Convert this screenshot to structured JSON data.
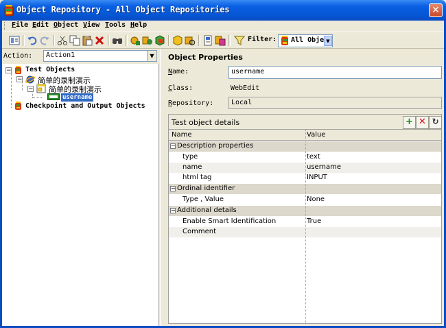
{
  "window": {
    "title": "Object Repository - All Object Repositories",
    "close_label": "✕"
  },
  "menu": [
    "File",
    "Edit",
    "Object",
    "View",
    "Tools",
    "Help"
  ],
  "toolbar": {
    "filter_label": "Filter:",
    "filter_value": "All Obje"
  },
  "action": {
    "label": "Action:",
    "value": "Action1"
  },
  "tree": {
    "root": "Test Objects",
    "browser": "简单的录制演示",
    "page": "简单的录制演示",
    "object": "username",
    "checkpoints": "Checkpoint and Output Objects"
  },
  "properties": {
    "header": "Object Properties",
    "name_label": "Name:",
    "name_value": "username",
    "class_label": "Class:",
    "class_value": "WebEdit",
    "repository_label": "Repository:",
    "repository_value": "Local"
  },
  "details": {
    "title": "Test object details",
    "col_name": "Name",
    "col_value": "Value",
    "groups": [
      {
        "label": "Description properties",
        "rows": [
          {
            "name": "type",
            "value": "text"
          },
          {
            "name": "name",
            "value": "username"
          },
          {
            "name": "html tag",
            "value": "INPUT"
          }
        ]
      },
      {
        "label": "Ordinal identifier",
        "rows": [
          {
            "name": "Type , Value",
            "value": "None"
          }
        ]
      },
      {
        "label": "Additional details",
        "rows": [
          {
            "name": "Enable Smart Identification",
            "value": "True"
          },
          {
            "name": "Comment",
            "value": ""
          }
        ]
      }
    ]
  },
  "colors": {
    "titlebar": "#0557d6",
    "selection": "#316ac5",
    "panel": "#ECE9D8"
  }
}
